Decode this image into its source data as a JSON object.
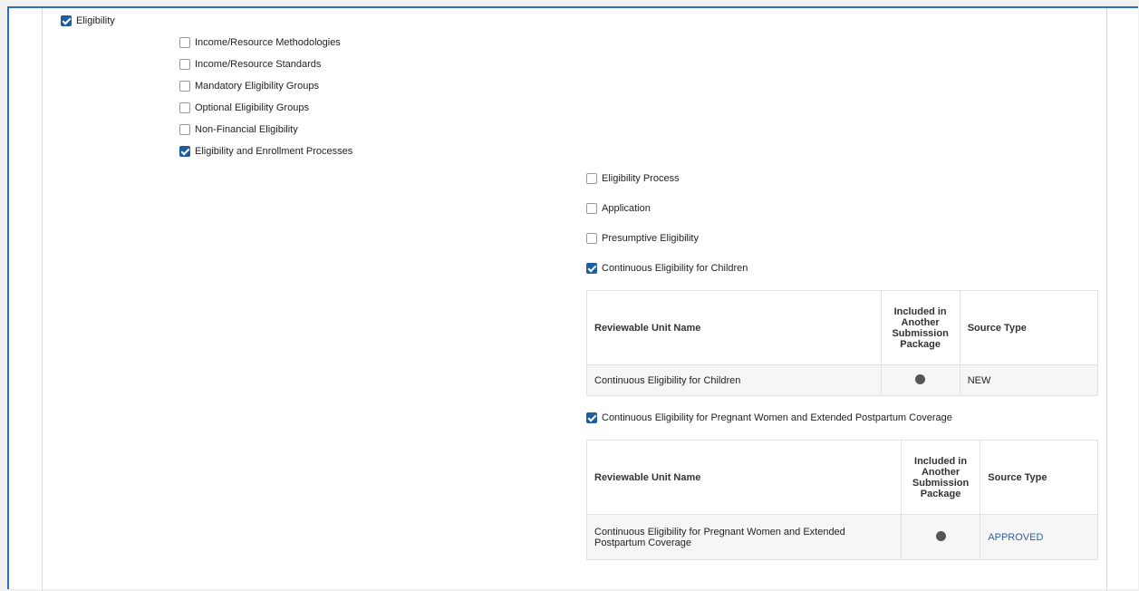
{
  "eligibility": {
    "label": "Eligibility",
    "checked": true,
    "items": [
      {
        "label": "Income/Resource Methodologies",
        "checked": false
      },
      {
        "label": "Income/Resource Standards",
        "checked": false
      },
      {
        "label": "Mandatory Eligibility Groups",
        "checked": false
      },
      {
        "label": "Optional Eligibility Groups",
        "checked": false
      },
      {
        "label": "Non-Financial Eligibility",
        "checked": false
      },
      {
        "label": "Eligibility and Enrollment Processes",
        "checked": true
      }
    ]
  },
  "processes": {
    "items": [
      {
        "label": "Eligibility Process",
        "checked": false
      },
      {
        "label": "Application",
        "checked": false
      },
      {
        "label": "Presumptive Eligibility",
        "checked": false
      },
      {
        "label": "Continuous Eligibility for Children",
        "checked": true
      },
      {
        "label": "Continuous Eligibility for Pregnant Women and Extended Postpartum Coverage",
        "checked": true
      }
    ]
  },
  "table_headers": {
    "name": "Reviewable Unit Name",
    "included": "Included in Another Submission Package",
    "source": "Source Type"
  },
  "table1": {
    "rows": [
      {
        "name": "Continuous Eligibility for Children",
        "source": "NEW"
      }
    ]
  },
  "table2": {
    "rows": [
      {
        "name": "Continuous Eligibility for Pregnant Women and Extended Postpartum Coverage",
        "source": "APPROVED"
      }
    ]
  },
  "colors": {
    "accent": "#1e5d9e",
    "frame_border": "#2a6ebb",
    "approved_link": "#2a5fa8",
    "dot": "#555555"
  },
  "icons": {
    "checked": "checkbox-checked-icon",
    "unchecked": "checkbox-unchecked-icon",
    "included_indicator": "filled-circle-icon"
  }
}
